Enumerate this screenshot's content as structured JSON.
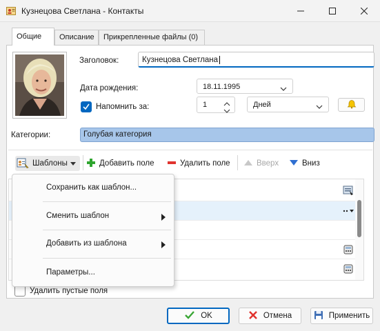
{
  "window": {
    "title": "Кузнецова Светлана  - Контакты"
  },
  "tabs": [
    {
      "label": "Общие",
      "active": true
    },
    {
      "label": "Описание",
      "active": false
    },
    {
      "label": "Прикрепленные файлы (0)",
      "active": false
    }
  ],
  "form": {
    "heading_label": "Заголовок:",
    "heading_value": "Кузнецова Светлана",
    "birthdate_label": "Дата рождения:",
    "birthdate_value": "18.11.1995",
    "remind_label": "Напомнить за:",
    "remind_checked": true,
    "remind_count": "1",
    "remind_unit": "Дней",
    "categories_label": "Категории:",
    "category_value": "Голубая категория"
  },
  "toolbar": {
    "templates": "Шаблоны",
    "add_field": "Добавить поле",
    "delete_field": "Удалить поле",
    "up": "Вверх",
    "down": "Вниз"
  },
  "templates_menu": {
    "items": [
      {
        "label": "Сохранить как шаблон...",
        "submenu": false
      },
      {
        "label": "Сменить шаблон",
        "submenu": true
      },
      {
        "label": "Добавить из шаблона",
        "submenu": true
      },
      {
        "label": "Параметры...",
        "submenu": false
      }
    ]
  },
  "options": {
    "delete_empty_label": "Удалить пустые поля",
    "delete_empty_checked": false
  },
  "buttons": {
    "ok": "OK",
    "cancel": "Отмена",
    "apply": "Применить"
  },
  "icons": {
    "window_icon": "contact-card-icon",
    "bell": "bell-icon",
    "ok": "checkmark-icon",
    "cancel": "red-x-icon",
    "apply": "floppy-disk-icon"
  },
  "colors": {
    "accent": "#0067c0",
    "category": "#a7c6ea"
  }
}
